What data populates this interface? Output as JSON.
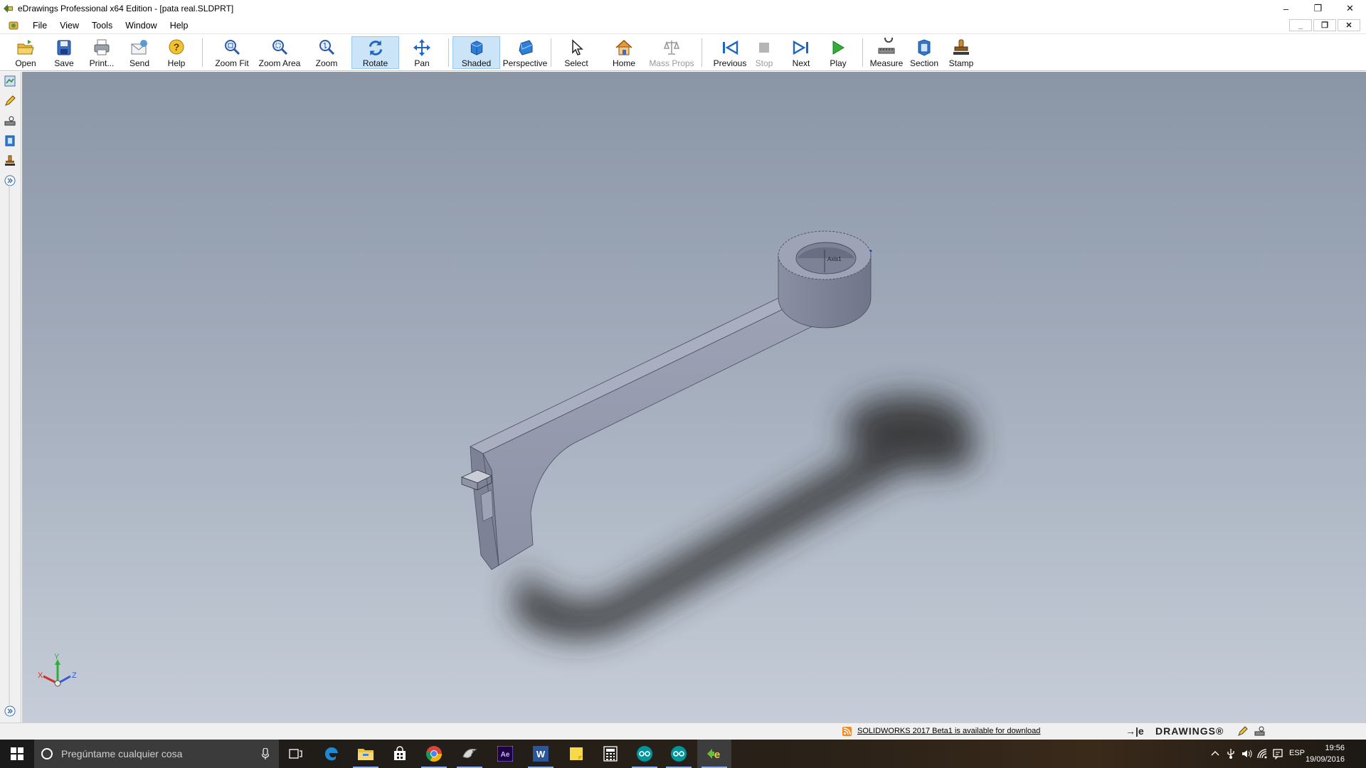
{
  "window": {
    "title": "eDrawings Professional x64 Edition - [pata real.SLDPRT]",
    "controls": {
      "minimize": "–",
      "restore": "❐",
      "close": "✕"
    },
    "mdi_controls": {
      "minimize": "_",
      "restore": "❐",
      "close": "✕"
    }
  },
  "menu": [
    "File",
    "View",
    "Tools",
    "Window",
    "Help"
  ],
  "toolbar": {
    "open": "Open",
    "save": "Save",
    "print": "Print...",
    "send": "Send",
    "help": "Help",
    "zoom_fit": "Zoom Fit",
    "zoom_area": "Zoom Area",
    "zoom": "Zoom",
    "rotate": "Rotate",
    "pan": "Pan",
    "shaded": "Shaded",
    "perspective": "Perspective",
    "select": "Select",
    "home": "Home",
    "mass_props": "Mass Props",
    "previous": "Previous",
    "stop": "Stop",
    "next": "Next",
    "play": "Play",
    "measure": "Measure",
    "section": "Section",
    "stamp": "Stamp"
  },
  "toolbar_state": {
    "active": [
      "Rotate",
      "Shaded"
    ],
    "disabled": [
      "Mass Props",
      "Stop"
    ]
  },
  "viewport": {
    "axis_label": "Axis1",
    "triad": {
      "x": "X",
      "y": "Y",
      "z": "Z"
    },
    "colors": {
      "bg_top": "#8a95a6",
      "bg_bottom": "#c6cdd8",
      "part": "#8a8fa3"
    }
  },
  "statusbar": {
    "update_link": "SOLIDWORKS 2017 Beta1 is available for download",
    "brand": "DRAWINGS®",
    "brand_prefix": "→|e"
  },
  "taskbar": {
    "search_placeholder": "Pregúntame cualquier cosa",
    "apps": [
      "task-view",
      "edge",
      "file-explorer",
      "store",
      "chrome",
      "app-bird",
      "after-effects",
      "word",
      "sticky-notes",
      "calculator",
      "arduino",
      "arduino-2",
      "edrawings"
    ],
    "language": "ESP",
    "time": "19:56",
    "date": "19/09/2016"
  }
}
